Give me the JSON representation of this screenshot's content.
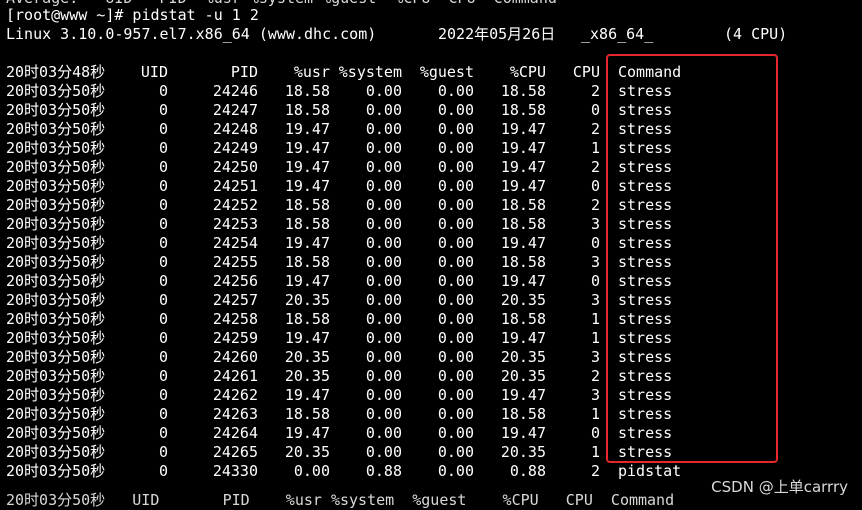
{
  "terminal": {
    "cut_top_line": "Average:   UID   PID  %usr %system %guest  %CPU  CPU  Command",
    "prompt_line": "[root@www ~]# pidstat -u 1 2",
    "info": {
      "kernel": "Linux 3.10.0-957.el7.x86_64 (www.dhc.com)",
      "date": "2022年05月26日",
      "arch": "_x86_64_",
      "cpus": "(4 CPU)"
    },
    "header": {
      "time": "20时03分48秒",
      "uid": "UID",
      "pid": "PID",
      "usr": "%usr",
      "system": "%system",
      "guest": "%guest",
      "cpu_pct": "%CPU",
      "cpu": "CPU",
      "command": "Command"
    },
    "rows": [
      {
        "time": "20时03分50秒",
        "uid": "0",
        "pid": "24246",
        "usr": "18.58",
        "system": "0.00",
        "guest": "0.00",
        "cpu_pct": "18.58",
        "cpu": "2",
        "command": "stress"
      },
      {
        "time": "20时03分50秒",
        "uid": "0",
        "pid": "24247",
        "usr": "18.58",
        "system": "0.00",
        "guest": "0.00",
        "cpu_pct": "18.58",
        "cpu": "0",
        "command": "stress"
      },
      {
        "time": "20时03分50秒",
        "uid": "0",
        "pid": "24248",
        "usr": "19.47",
        "system": "0.00",
        "guest": "0.00",
        "cpu_pct": "19.47",
        "cpu": "2",
        "command": "stress"
      },
      {
        "time": "20时03分50秒",
        "uid": "0",
        "pid": "24249",
        "usr": "19.47",
        "system": "0.00",
        "guest": "0.00",
        "cpu_pct": "19.47",
        "cpu": "1",
        "command": "stress"
      },
      {
        "time": "20时03分50秒",
        "uid": "0",
        "pid": "24250",
        "usr": "19.47",
        "system": "0.00",
        "guest": "0.00",
        "cpu_pct": "19.47",
        "cpu": "2",
        "command": "stress"
      },
      {
        "time": "20时03分50秒",
        "uid": "0",
        "pid": "24251",
        "usr": "19.47",
        "system": "0.00",
        "guest": "0.00",
        "cpu_pct": "19.47",
        "cpu": "0",
        "command": "stress"
      },
      {
        "time": "20时03分50秒",
        "uid": "0",
        "pid": "24252",
        "usr": "18.58",
        "system": "0.00",
        "guest": "0.00",
        "cpu_pct": "18.58",
        "cpu": "2",
        "command": "stress"
      },
      {
        "time": "20时03分50秒",
        "uid": "0",
        "pid": "24253",
        "usr": "18.58",
        "system": "0.00",
        "guest": "0.00",
        "cpu_pct": "18.58",
        "cpu": "3",
        "command": "stress"
      },
      {
        "time": "20时03分50秒",
        "uid": "0",
        "pid": "24254",
        "usr": "19.47",
        "system": "0.00",
        "guest": "0.00",
        "cpu_pct": "19.47",
        "cpu": "0",
        "command": "stress"
      },
      {
        "time": "20时03分50秒",
        "uid": "0",
        "pid": "24255",
        "usr": "18.58",
        "system": "0.00",
        "guest": "0.00",
        "cpu_pct": "18.58",
        "cpu": "3",
        "command": "stress"
      },
      {
        "time": "20时03分50秒",
        "uid": "0",
        "pid": "24256",
        "usr": "19.47",
        "system": "0.00",
        "guest": "0.00",
        "cpu_pct": "19.47",
        "cpu": "0",
        "command": "stress"
      },
      {
        "time": "20时03分50秒",
        "uid": "0",
        "pid": "24257",
        "usr": "20.35",
        "system": "0.00",
        "guest": "0.00",
        "cpu_pct": "20.35",
        "cpu": "3",
        "command": "stress"
      },
      {
        "time": "20时03分50秒",
        "uid": "0",
        "pid": "24258",
        "usr": "18.58",
        "system": "0.00",
        "guest": "0.00",
        "cpu_pct": "18.58",
        "cpu": "1",
        "command": "stress"
      },
      {
        "time": "20时03分50秒",
        "uid": "0",
        "pid": "24259",
        "usr": "19.47",
        "system": "0.00",
        "guest": "0.00",
        "cpu_pct": "19.47",
        "cpu": "1",
        "command": "stress"
      },
      {
        "time": "20时03分50秒",
        "uid": "0",
        "pid": "24260",
        "usr": "20.35",
        "system": "0.00",
        "guest": "0.00",
        "cpu_pct": "20.35",
        "cpu": "3",
        "command": "stress"
      },
      {
        "time": "20时03分50秒",
        "uid": "0",
        "pid": "24261",
        "usr": "20.35",
        "system": "0.00",
        "guest": "0.00",
        "cpu_pct": "20.35",
        "cpu": "2",
        "command": "stress"
      },
      {
        "time": "20时03分50秒",
        "uid": "0",
        "pid": "24262",
        "usr": "19.47",
        "system": "0.00",
        "guest": "0.00",
        "cpu_pct": "19.47",
        "cpu": "3",
        "command": "stress"
      },
      {
        "time": "20时03分50秒",
        "uid": "0",
        "pid": "24263",
        "usr": "18.58",
        "system": "0.00",
        "guest": "0.00",
        "cpu_pct": "18.58",
        "cpu": "1",
        "command": "stress"
      },
      {
        "time": "20时03分50秒",
        "uid": "0",
        "pid": "24264",
        "usr": "19.47",
        "system": "0.00",
        "guest": "0.00",
        "cpu_pct": "19.47",
        "cpu": "0",
        "command": "stress"
      },
      {
        "time": "20时03分50秒",
        "uid": "0",
        "pid": "24265",
        "usr": "20.35",
        "system": "0.00",
        "guest": "0.00",
        "cpu_pct": "20.35",
        "cpu": "1",
        "command": "stress"
      },
      {
        "time": "20时03分50秒",
        "uid": "0",
        "pid": "24330",
        "usr": "0.00",
        "system": "0.88",
        "guest": "0.00",
        "cpu_pct": "0.88",
        "cpu": "2",
        "command": "pidstat"
      }
    ],
    "cut_bottom_line": "20时03分50秒   UID       PID    %usr %system  %guest    %CPU   CPU  Command"
  },
  "watermark": "CSDN @上单carrry",
  "colors": {
    "background": "#000000",
    "text": "#ffffff",
    "highlight_border": "#e8262d"
  }
}
